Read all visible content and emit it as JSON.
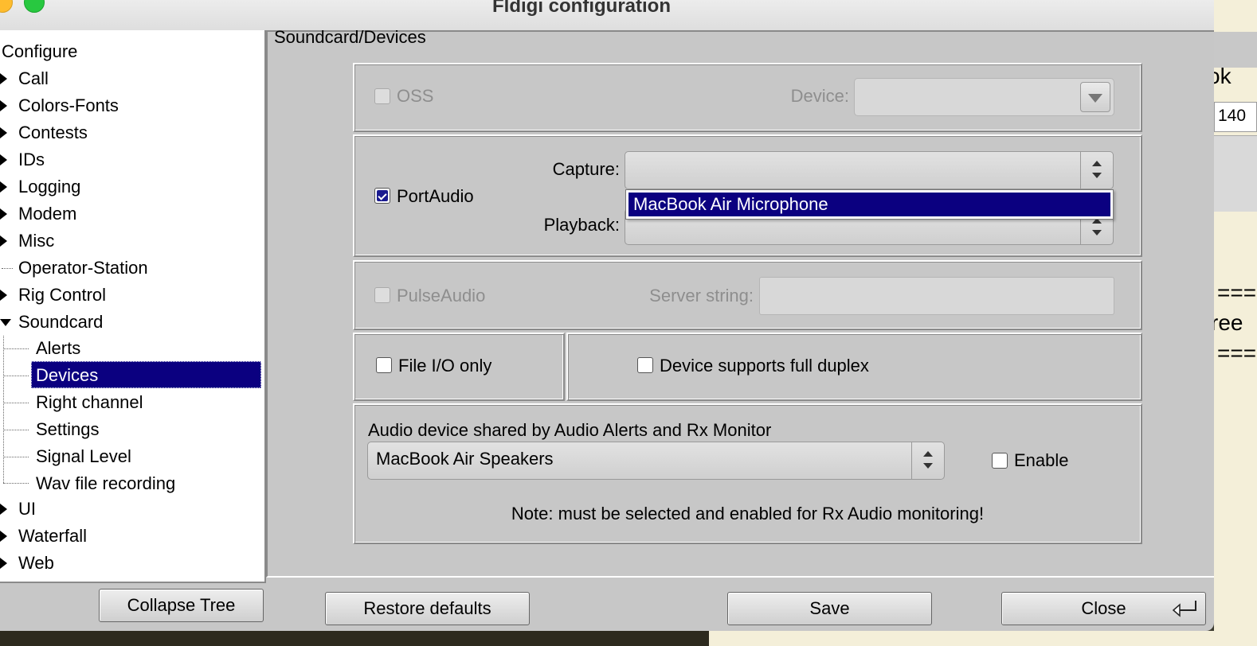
{
  "window": {
    "title": "Fldigi configuration"
  },
  "tree": {
    "root": "Configure",
    "items": [
      {
        "label": "Call",
        "expandable": true
      },
      {
        "label": "Colors-Fonts",
        "expandable": true
      },
      {
        "label": "Contests",
        "expandable": true
      },
      {
        "label": "IDs",
        "expandable": true
      },
      {
        "label": "Logging",
        "expandable": true
      },
      {
        "label": "Modem",
        "expandable": true
      },
      {
        "label": "Misc",
        "expandable": true
      },
      {
        "label": "Operator-Station",
        "expandable": false
      },
      {
        "label": "Rig Control",
        "expandable": true
      },
      {
        "label": "Soundcard",
        "expandable": true,
        "expanded": true
      },
      {
        "label": "Alerts",
        "child": true
      },
      {
        "label": "Devices",
        "child": true,
        "selected": true
      },
      {
        "label": "Right channel",
        "child": true
      },
      {
        "label": "Settings",
        "child": true
      },
      {
        "label": "Signal Level",
        "child": true
      },
      {
        "label": "Wav file recording",
        "child": true
      },
      {
        "label": "UI",
        "expandable": true
      },
      {
        "label": "Waterfall",
        "expandable": true
      },
      {
        "label": "Web",
        "expandable": true
      }
    ]
  },
  "panel": {
    "title": "Soundcard/Devices",
    "oss": {
      "label": "OSS",
      "checked": false,
      "device_label": "Device:",
      "device_value": ""
    },
    "portaudio": {
      "label": "PortAudio",
      "checked": true,
      "capture_label": "Capture:",
      "capture_value": "",
      "playback_label": "Playback:",
      "playback_value": "",
      "popup_option": "MacBook Air Microphone"
    },
    "pulseaudio": {
      "label": "PulseAudio",
      "checked": false,
      "server_label": "Server string:",
      "server_value": ""
    },
    "file_io": {
      "label": "File I/O only",
      "checked": false
    },
    "full_duplex": {
      "label": "Device supports full duplex",
      "checked": false
    },
    "shared": {
      "heading": "Audio device shared by Audio Alerts and Rx Monitor",
      "device_value": "MacBook Air Speakers",
      "enable_label": "Enable",
      "enable_checked": false,
      "note": "Note: must be selected and enabled for Rx Audio monitoring!"
    }
  },
  "buttons": {
    "collapse_tree": "Collapse Tree",
    "restore_defaults": "Restore defaults",
    "save": "Save",
    "close": "Close"
  },
  "background_app": {
    "text1": "ok",
    "num": "140",
    "text2": "===",
    "text3": "ree",
    "text4": "==="
  },
  "colors": {
    "selection": "#0b0080",
    "panel": "#c7c7c7"
  }
}
